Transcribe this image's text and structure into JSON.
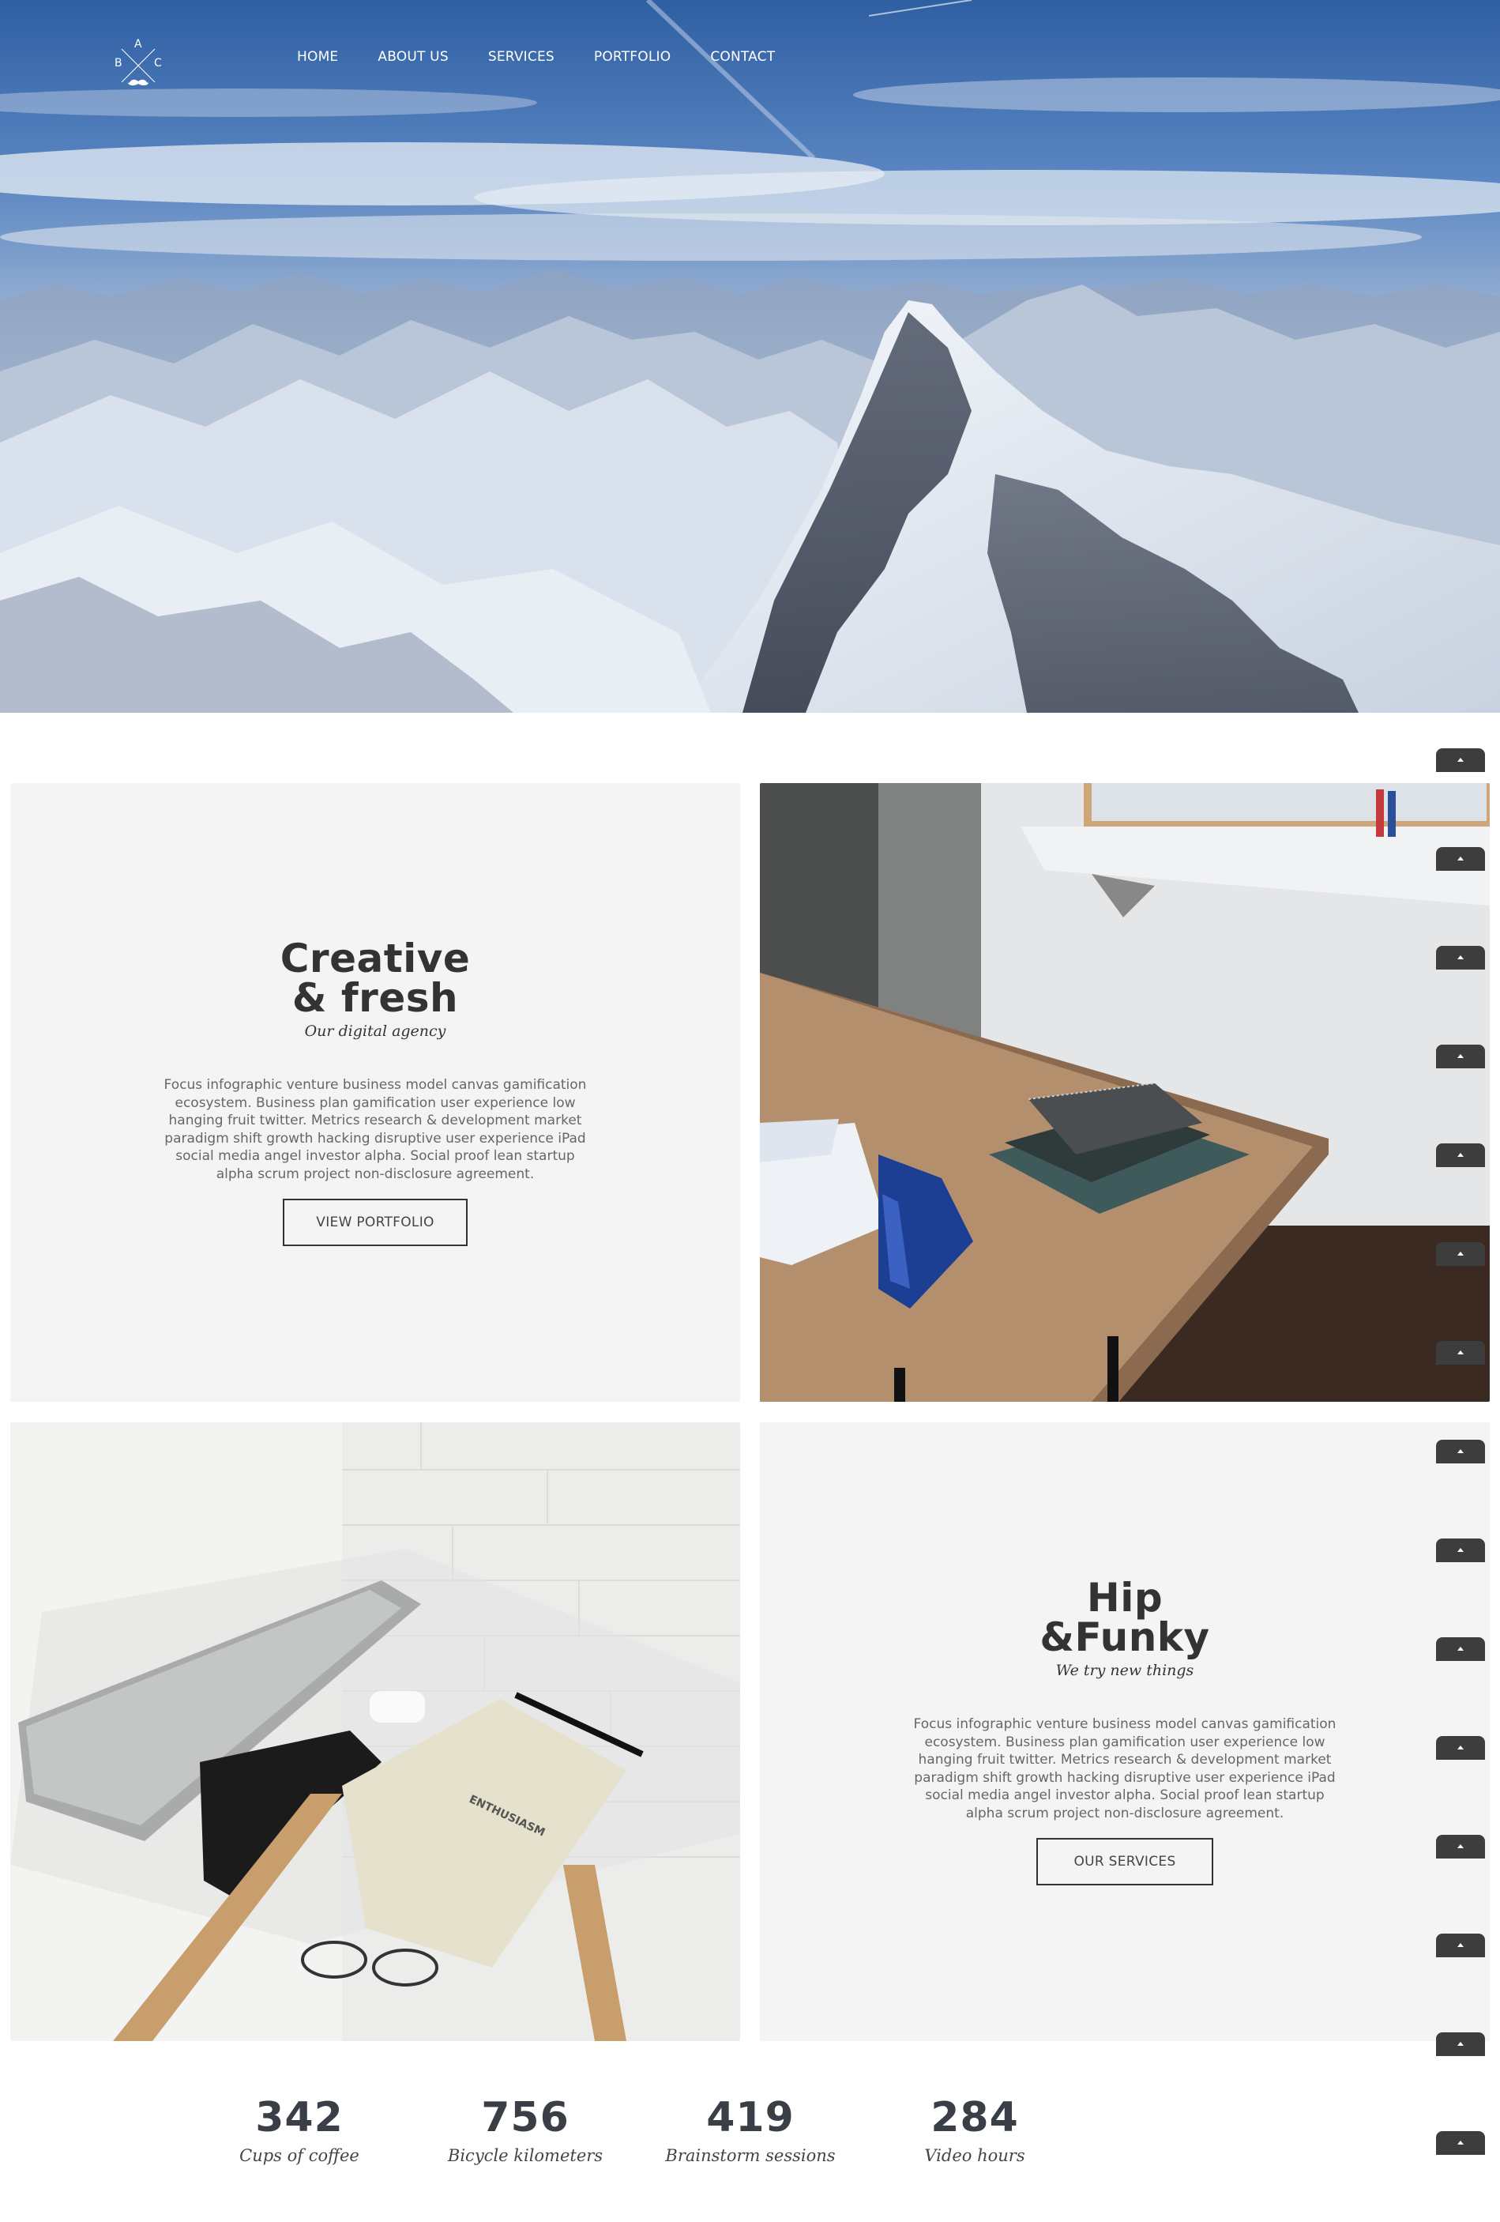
{
  "logo": {
    "letters": [
      "A",
      "B",
      "C"
    ],
    "mustache_icon": "mustache-icon"
  },
  "nav": {
    "items": [
      {
        "label": "HOME"
      },
      {
        "label": "ABOUT US"
      },
      {
        "label": "SERVICES"
      },
      {
        "label": "PORTFOLIO"
      },
      {
        "label": "CONTACT"
      }
    ]
  },
  "hero": {
    "image": "snowy-mountain-range-photo"
  },
  "creative": {
    "title_line1": "Creative",
    "title_line2": "& fresh",
    "subtitle": "Our digital agency",
    "body": "Focus infographic venture business model canvas gamification ecosystem. Business plan gamification user experience low hanging fruit twitter. Metrics research & development market paradigm shift growth hacking disruptive user experience iPad social media angel investor alpha. Social proof lean startup alpha scrum project non-disclosure agreement.",
    "button": "VIEW PORTFOLIO"
  },
  "workspace_photo_1": {
    "image": "wooden-desk-with-notebooks-photo"
  },
  "workspace_photo_2": {
    "image": "glass-desk-with-laptop-phone-notebook-photo"
  },
  "funky": {
    "title_line1": "Hip",
    "title_line2": "&Funky",
    "subtitle": "We try new things",
    "body": "Focus infographic venture business model canvas gamification ecosystem. Business plan gamification user experience low hanging fruit twitter. Metrics research & development market paradigm shift growth hacking disruptive user experience iPad social media angel investor alpha. Social proof lean startup alpha scrum project non-disclosure agreement.",
    "button": "OUR SERVICES"
  },
  "stats": [
    {
      "value": "342",
      "label": "Cups of coffee"
    },
    {
      "value": "756",
      "label": "Bicycle kilometers"
    },
    {
      "value": "419",
      "label": "Brainstorm sessions"
    },
    {
      "value": "284",
      "label": "Video hours"
    }
  ],
  "side_tab_icon": "chevron-up-icon",
  "colors": {
    "dark_text": "#333333",
    "tile_bg": "#f4f4f4",
    "tab": "#3d3d3d"
  }
}
